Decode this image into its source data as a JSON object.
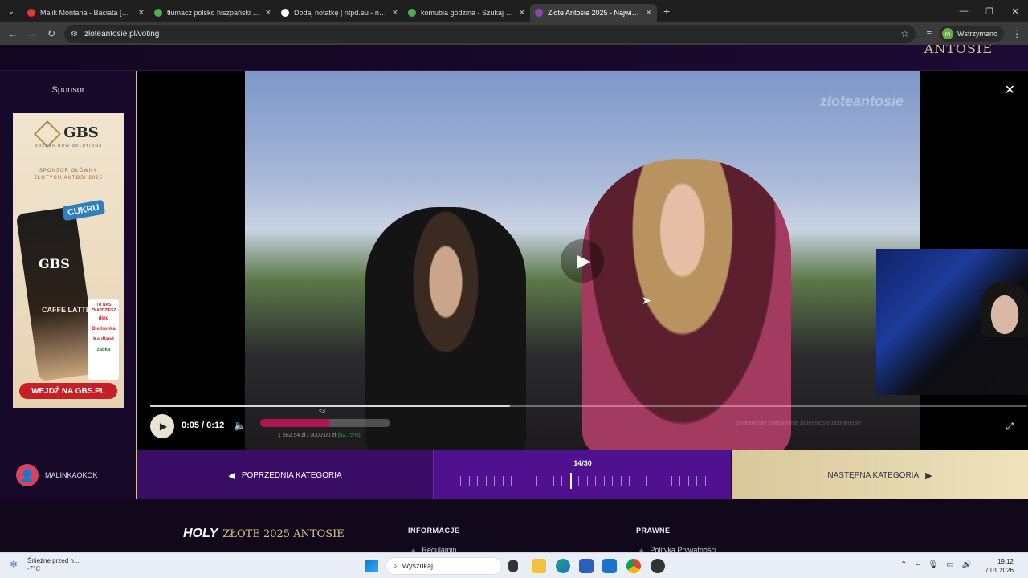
{
  "browser": {
    "tabs": [
      {
        "title": "Malik Montana - Baciata [Offici...",
        "color": "#e53935",
        "active": false
      },
      {
        "title": "tłumacz polsko hiszpański - Szu...",
        "color": "#4caf50",
        "active": false
      },
      {
        "title": "Dodaj notatkę | ntpd.eu - notat...",
        "color": "#ffffff",
        "active": false
      },
      {
        "title": "komubia godzina - Szukaj w Go...",
        "color": "#4caf50",
        "active": false
      },
      {
        "title": "Złote Antosie 2025 - Najwięks...",
        "color": "#8e44ad",
        "active": true
      }
    ],
    "url": "zloteantosie.pl/voting",
    "profile_initial": "m",
    "profile_label": "Wstrzymano"
  },
  "page": {
    "top_logo": "ANTOSIE",
    "sponsor_label": "Sponsor",
    "ad": {
      "brand": "GBS",
      "brand_sub": "GOLDEN BOW SOLUTIONS",
      "tagline_1": "SPONSOR GŁÓWNY",
      "tagline_2": "ZŁOTYCH ANTOSI 2025",
      "cukru": "CUKRU",
      "can_logo": "GBS",
      "can_label": "CAFFE LATTE",
      "stores_title": "TU NAS ZNAJDZIESZ",
      "stores": [
        "dino",
        "Biedronka",
        "Kaufland",
        "żabka"
      ],
      "cta": "WEJDŹ NA GBS.PL"
    },
    "video": {
      "watermark": "złoteantosie",
      "time": "0:05 / 0:12",
      "progress_fraction": 0.41,
      "donate_label": "<3",
      "donate_fraction": 0.53,
      "donate_amount": "1 582.54 zł / 3000.00 zł",
      "donate_percent": "(52.75%)",
      "socials": "zloteantosie   zloteantosie   zloteantosie   zloteantosie"
    },
    "user_name": "MALINKAOKOK",
    "prev_category": "POPRZEDNIA KATEGORIA",
    "next_category": "NASTĘPNA KATEGORIA",
    "category_counter": "14/30",
    "category_total": 30,
    "category_current": 14,
    "footer": {
      "logo_holy": "HOLY",
      "logo_gold": "ZŁOTE 2025 ANTOSIE",
      "info_heading": "INFORMACJE",
      "info_link": "Regulamin",
      "legal_heading": "PRAWNE",
      "legal_link": "Polityka Prywatności"
    }
  },
  "taskbar": {
    "weather_title": "Śnieżne przed n...",
    "weather_temp": "-7°C",
    "search_placeholder": "Wyszukaj",
    "time": "19:12",
    "date": "7.01.2026"
  }
}
